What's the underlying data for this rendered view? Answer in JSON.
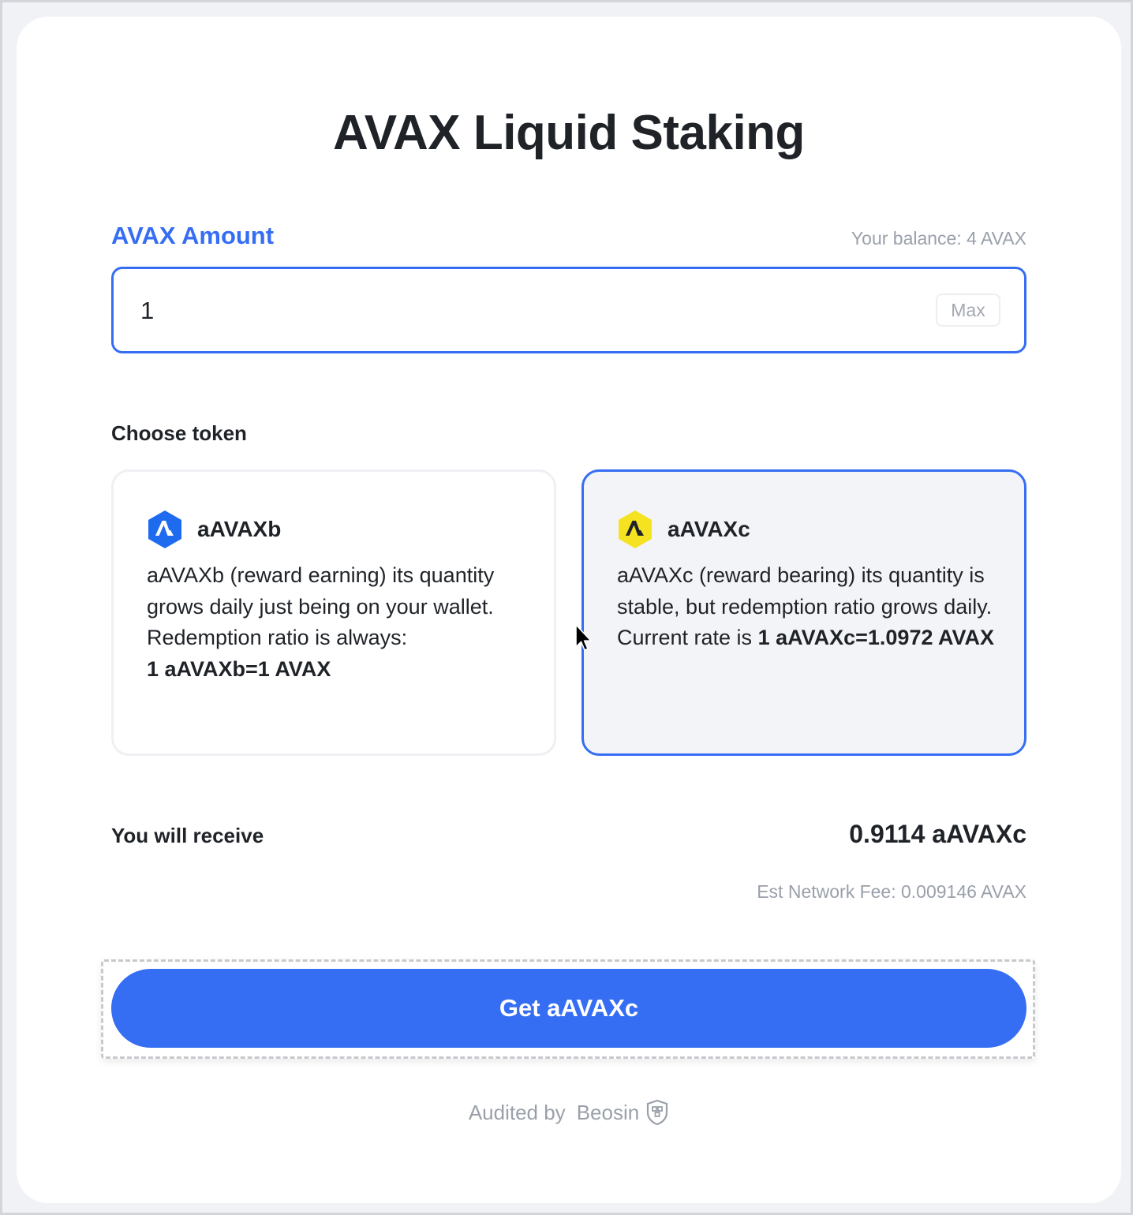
{
  "page": {
    "title": "AVAX Liquid Staking"
  },
  "amount": {
    "label": "AVAX Amount",
    "balance_text": "Your balance: 4 AVAX",
    "value": "1",
    "max_label": "Max"
  },
  "choose": {
    "label": "Choose token",
    "selected": "aAVAXc",
    "tokens": [
      {
        "name": "aAVAXb",
        "icon": "avax-blue-hexagon-icon",
        "icon_color": "#1f6bf0",
        "desc_prefix": "aAVAXb (reward earning) its quantity grows daily just being on your wallet. Redemption ratio is always:",
        "desc_rate": "1 aAVAXb=1 AVAX"
      },
      {
        "name": "aAVAXc",
        "icon": "avax-yellow-hexagon-icon",
        "icon_color": "#f5e221",
        "desc_prefix": "aAVAXc (reward bearing) its quantity is stable, but redemption ratio grows daily.",
        "desc_rate_lead": "Current rate is",
        "desc_rate": "1 aAVAXc=1.0972 AVAX"
      }
    ]
  },
  "receive": {
    "label": "You will receive",
    "value": "0.9114 aAVAXc",
    "fee": "Est Network Fee: 0.009146 AVAX"
  },
  "action": {
    "button_label": "Get aAVAXc"
  },
  "footer": {
    "audited_by": "Audited by",
    "auditor": "Beosin",
    "auditor_icon": "beosin-shield-icon"
  },
  "colors": {
    "accent": "#356df3",
    "muted": "#9aa0aa",
    "selected_card_bg": "#f3f4f7"
  }
}
